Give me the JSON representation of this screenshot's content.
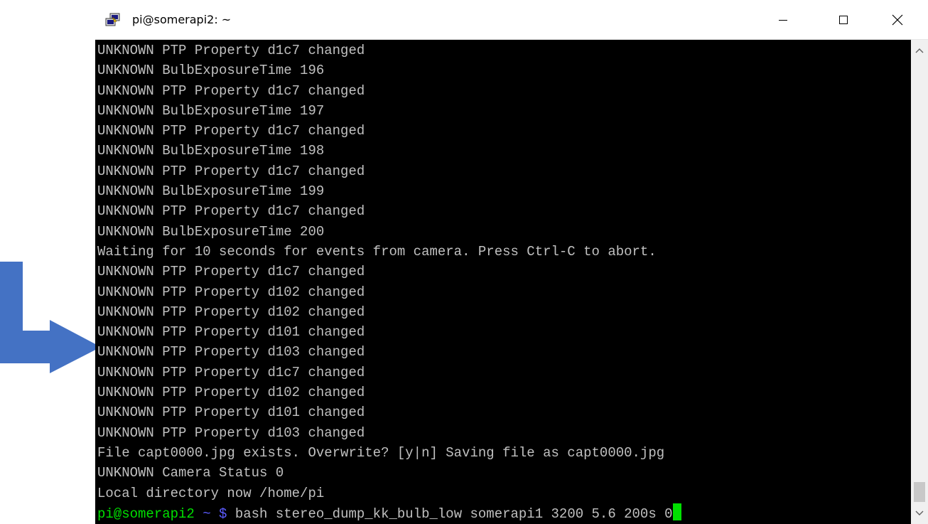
{
  "window": {
    "title": "pi@somerapi2: ~"
  },
  "terminal": {
    "lines": [
      "UNKNOWN PTP Property d1c7 changed",
      "UNKNOWN BulbExposureTime 196",
      "UNKNOWN PTP Property d1c7 changed",
      "UNKNOWN BulbExposureTime 197",
      "UNKNOWN PTP Property d1c7 changed",
      "UNKNOWN BulbExposureTime 198",
      "UNKNOWN PTP Property d1c7 changed",
      "UNKNOWN BulbExposureTime 199",
      "UNKNOWN PTP Property d1c7 changed",
      "UNKNOWN BulbExposureTime 200",
      "Waiting for 10 seconds for events from camera. Press Ctrl-C to abort.",
      "UNKNOWN PTP Property d1c7 changed",
      "UNKNOWN PTP Property d102 changed",
      "UNKNOWN PTP Property d102 changed",
      "UNKNOWN PTP Property d101 changed",
      "UNKNOWN PTP Property d103 changed",
      "UNKNOWN PTP Property d1c7 changed",
      "UNKNOWN PTP Property d102 changed",
      "UNKNOWN PTP Property d101 changed",
      "UNKNOWN PTP Property d103 changed",
      "File capt0000.jpg exists. Overwrite? [y|n] Saving file as capt0000.jpg",
      "UNKNOWN Camera Status 0",
      "Local directory now /home/pi"
    ],
    "prompt": {
      "user_host": "pi@somerapi2",
      "path": " ~ $ ",
      "command": "bash stereo_dump_kk_bulb_low somerapi1 3200 5.6 200s 0"
    }
  },
  "colors": {
    "arrow": "#4472c4",
    "prompt_user": "#00e000",
    "prompt_path": "#5c5cff",
    "text": "#c0c0c0",
    "background": "#000000"
  },
  "icons": {
    "app": "putty-icon",
    "minimize": "minimize-icon",
    "maximize": "maximize-icon",
    "close": "close-icon",
    "scroll_up": "chevron-up-icon",
    "scroll_down": "chevron-down-icon",
    "annotation": "arrow-right-icon"
  }
}
